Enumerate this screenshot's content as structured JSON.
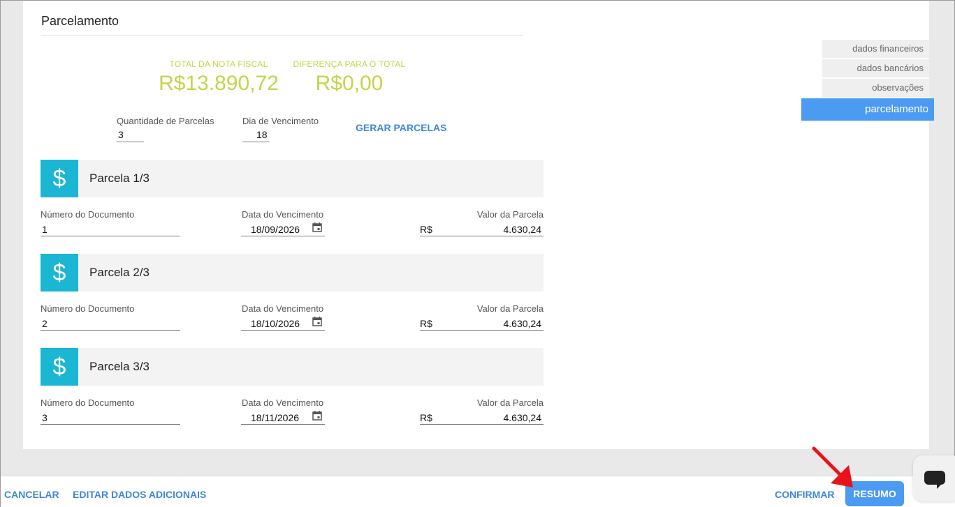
{
  "section": {
    "title": "Parcelamento"
  },
  "totals": {
    "nota_label": "TOTAL DA NOTA FISCAL",
    "nota_value": "R$13.890,72",
    "diff_label": "DIFERENÇA PARA O TOTAL",
    "diff_value": "R$0,00"
  },
  "config": {
    "qtd_label": "Quantidade de Parcelas",
    "qtd_value": "3",
    "dia_label": "Dia de Vencimento",
    "dia_value": "18",
    "gerar_label": "GERAR PARCELAS"
  },
  "parcelas": [
    {
      "title": "Parcela 1/3",
      "doc_label": "Número do Documento",
      "doc": "1",
      "venc_label": "Data do Vencimento",
      "venc": "18/09/2026",
      "valor_label": "Valor da Parcela",
      "currency": "R$",
      "valor": "4.630,24"
    },
    {
      "title": "Parcela 2/3",
      "doc_label": "Número do Documento",
      "doc": "2",
      "venc_label": "Data do Vencimento",
      "venc": "18/10/2026",
      "valor_label": "Valor da Parcela",
      "currency": "R$",
      "valor": "4.630,24"
    },
    {
      "title": "Parcela 3/3",
      "doc_label": "Número do Documento",
      "doc": "3",
      "venc_label": "Data do Vencimento",
      "venc": "18/11/2026",
      "valor_label": "Valor da Parcela",
      "currency": "R$",
      "valor": "4.630,24"
    }
  ],
  "dollar_glyph": "$",
  "tabs": [
    "dados financeiros",
    "dados bancários",
    "observações",
    "parcelamento"
  ],
  "bottom": {
    "cancelar": "CANCELAR",
    "editar": "EDITAR DADOS ADICIONAIS",
    "confirmar": "CONFIRMAR",
    "resumo": "RESUMO"
  },
  "colors": {
    "accent_blue": "#4c9bf2",
    "link_blue": "#3f86d8",
    "cyan_icon": "#1ab6d3",
    "total_green": "#c5d44a",
    "annotation_red": "#e8121b"
  },
  "icons": [
    "dollar-icon",
    "calendar-icon",
    "chat-icon",
    "red-arrow"
  ]
}
